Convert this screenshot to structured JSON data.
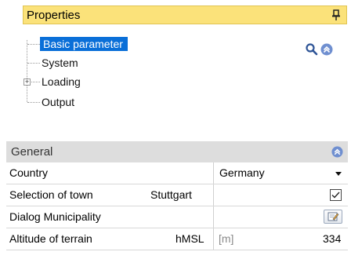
{
  "properties": {
    "title": "Properties"
  },
  "tree": {
    "items": [
      {
        "label": "Basic parameter",
        "selected": true
      },
      {
        "label": "System"
      },
      {
        "label": "Loading",
        "expandable": true,
        "expander": "+"
      },
      {
        "label": "Output"
      }
    ]
  },
  "general": {
    "title": "General",
    "rows": [
      {
        "label": "Country",
        "symbol": "",
        "unit": "",
        "value": "Germany",
        "control": "dropdown"
      },
      {
        "label": "Selection of town",
        "symbol": "Stuttgart",
        "unit": "",
        "value": "",
        "control": "checkbox",
        "checked": true
      },
      {
        "label": "Dialog Municipality",
        "symbol": "",
        "unit": "",
        "value": "",
        "control": "dialog-button"
      },
      {
        "label": "Altitude of terrain",
        "symbol": "hMSL",
        "unit": "[m]",
        "value": "334",
        "control": "none"
      }
    ]
  },
  "colors": {
    "header_yellow": "#fbe27a",
    "selection_blue": "#0a6fd8",
    "section_gray": "#dddddd",
    "icon_blue": "#5b7bc0"
  },
  "icons": {
    "pin": "pin-icon",
    "search": "search-icon",
    "collapse": "collapse-up-icon",
    "dialog": "edit-dialog-icon"
  }
}
